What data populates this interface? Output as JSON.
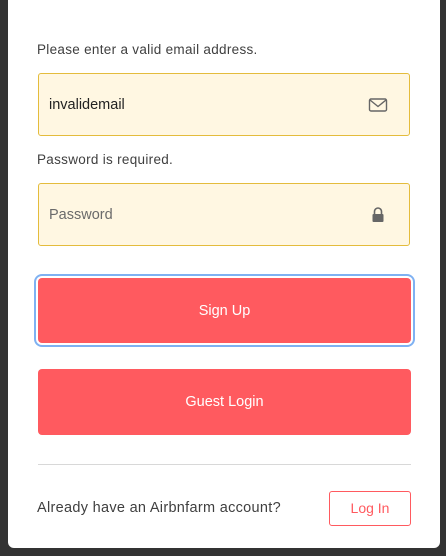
{
  "form": {
    "email_error": "Please enter a valid email address.",
    "email_value": "invalidemail",
    "email_icon": "envelope-icon",
    "password_error": "Password is required.",
    "password_placeholder": "Password",
    "password_icon": "lock-icon"
  },
  "buttons": {
    "signup_label": "Sign Up",
    "guest_label": "Guest Login"
  },
  "footer": {
    "prompt": "Already have an Airbnfarm account?",
    "login_label": "Log In"
  },
  "colors": {
    "accent": "#ff5a5f",
    "field_bg": "#fff7e2",
    "field_border": "#e4bc3c",
    "focus_ring": "#7fb1f2"
  }
}
